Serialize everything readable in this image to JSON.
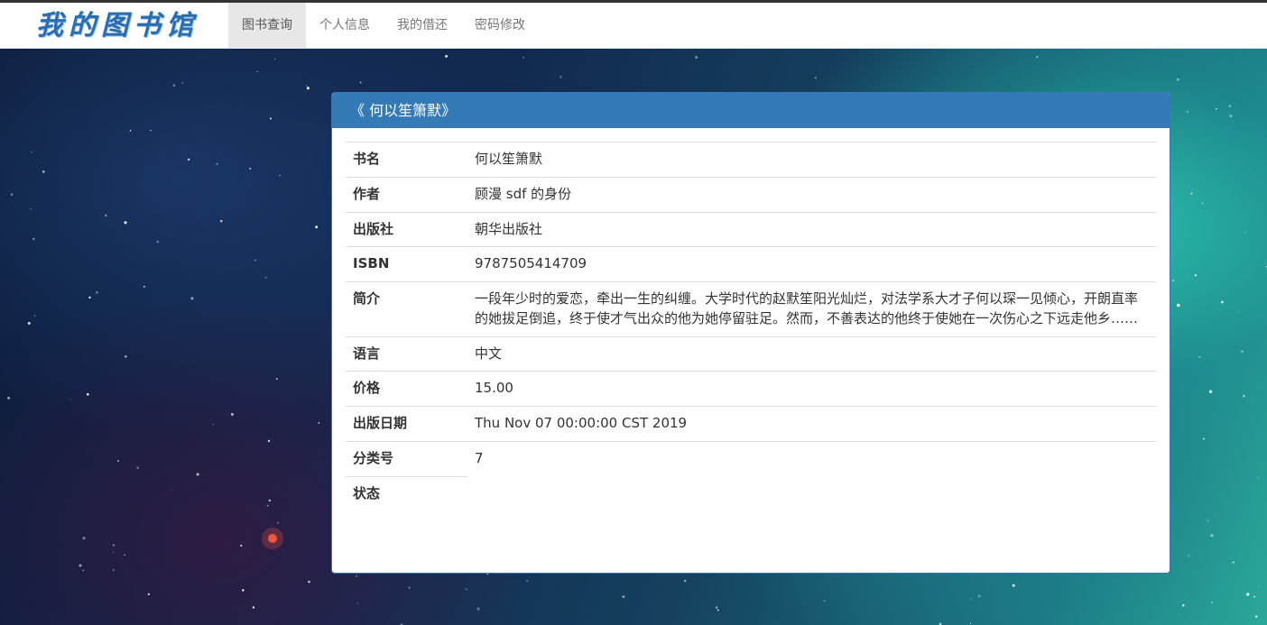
{
  "nav": {
    "brand": "我的图书馆",
    "items": [
      {
        "label": "图书查询",
        "active": true
      },
      {
        "label": "个人信息",
        "active": false
      },
      {
        "label": "我的借还",
        "active": false
      },
      {
        "label": "密码修改",
        "active": false
      }
    ]
  },
  "panel": {
    "title": "《 何以笙箫默》",
    "rows": [
      {
        "label": "书名",
        "value": "何以笙箫默"
      },
      {
        "label": "作者",
        "value": "顾漫 sdf 的身份"
      },
      {
        "label": "出版社",
        "value": "朝华出版社"
      },
      {
        "label": "ISBN",
        "value": "9787505414709"
      },
      {
        "label": "简介",
        "value": "一段年少时的爱恋，牵出一生的纠缠。大学时代的赵默笙阳光灿烂，对法学系大才子何以琛一见倾心，开朗直率的她拔足倒追，终于使才气出众的他为她停留驻足。然而，不善表达的他终于使她在一次伤心之下远走他乡……"
      },
      {
        "label": "语言",
        "value": "中文"
      },
      {
        "label": "价格",
        "value": "15.00"
      },
      {
        "label": "出版日期",
        "value": "Thu Nov 07 00:00:00 CST 2019"
      },
      {
        "label": "分类号",
        "value": "7"
      },
      {
        "label": "状态",
        "value": ""
      }
    ]
  },
  "colors": {
    "primary": "#337ab7",
    "brand": "#2a6db0",
    "nav_active_bg": "#e7e7e7"
  }
}
